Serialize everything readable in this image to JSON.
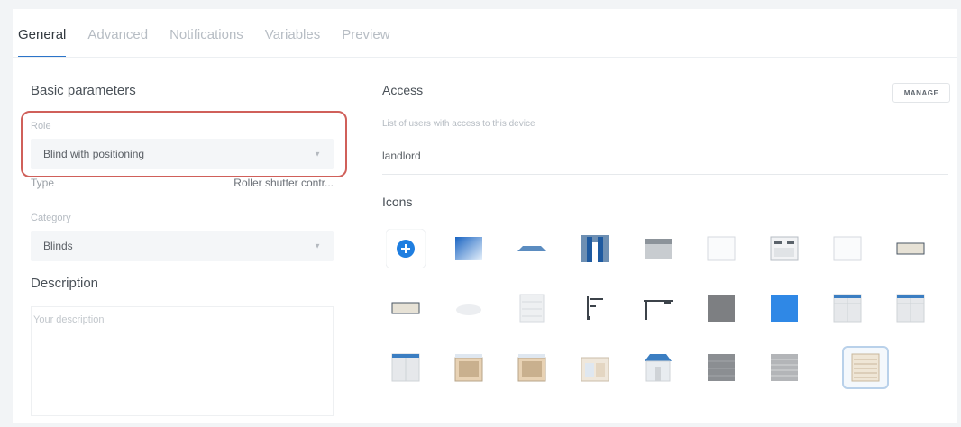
{
  "tabs": [
    {
      "label": "General",
      "active": true
    },
    {
      "label": "Advanced",
      "active": false
    },
    {
      "label": "Notifications",
      "active": false
    },
    {
      "label": "Variables",
      "active": false
    },
    {
      "label": "Preview",
      "active": false
    }
  ],
  "basic": {
    "title": "Basic parameters",
    "role_label": "Role",
    "role_value": "Blind with positioning",
    "type_label": "Type",
    "type_value": "Roller shutter contr...",
    "category_label": "Category",
    "category_value": "Blinds",
    "description_title": "Description",
    "description_placeholder": "Your description"
  },
  "access": {
    "title": "Access",
    "manage_label": "MANAGE",
    "hint": "List of users with access to this device",
    "value": "landlord"
  },
  "icons": {
    "title": "Icons",
    "rows": [
      [
        "add-icon",
        "gradient-blind-icon",
        "awning-icon",
        "curtains-icon",
        "gray-shutter-icon",
        "empty-frame-icon",
        "window-panel-icon",
        "empty-frame-icon",
        "flower-box-icon"
      ],
      [
        "flower-box-icon",
        "cloud-icon",
        "louver-icon",
        "pole-blind-icon",
        "pole-curtain-icon",
        "dark-gray-square-icon",
        "blue-square-icon",
        "window-blind-icon",
        "window-blind-icon"
      ],
      [
        "blue-blind-icon",
        "wooden-fence-icon",
        "wooden-fence-icon",
        "fence-window-icon",
        "shop-awning-icon",
        "gray-blind-icon",
        "slatted-blind-icon",
        "venetian-blind-selected-icon"
      ]
    ],
    "selected_index": [
      2,
      7
    ]
  },
  "colors": {
    "accent": "#2b74c9",
    "highlight": "#d0605a",
    "blue": "#2f88e6"
  }
}
